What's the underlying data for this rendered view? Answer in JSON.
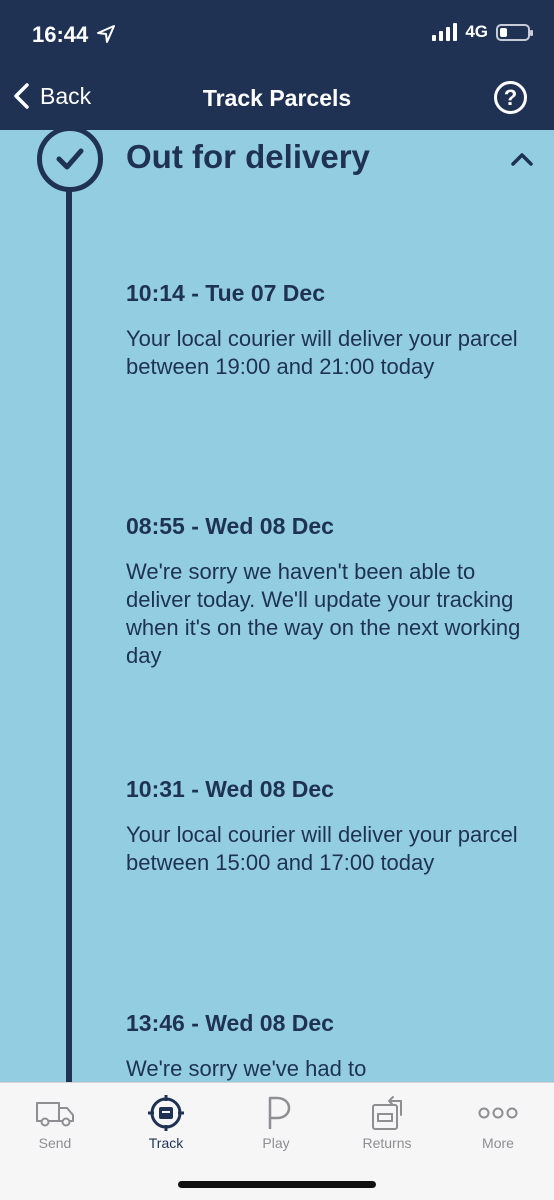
{
  "status_bar": {
    "time": "16:44",
    "network": "4G"
  },
  "nav": {
    "back_label": "Back",
    "title": "Track Parcels",
    "help_symbol": "?"
  },
  "section": {
    "title": "Out for delivery",
    "icon": "check-circle-icon"
  },
  "events": [
    {
      "time": "10:14 - Tue 07 Dec",
      "description": "Your local courier will deliver your parcel between 19:00 and 21:00 today"
    },
    {
      "time": "08:55 - Wed 08 Dec",
      "description": "We're sorry we haven't been able to deliver today. We'll update your tracking when it's on the way on the next working day"
    },
    {
      "time": "10:31 - Wed 08 Dec",
      "description": "Your local courier will deliver your parcel between 15:00 and 17:00 today"
    },
    {
      "time": "13:46 - Wed 08 Dec",
      "description": "We're sorry we've had to"
    }
  ],
  "tabs": [
    {
      "label": "Send",
      "icon": "van-icon",
      "active": false
    },
    {
      "label": "Track",
      "icon": "target-parcel-icon",
      "active": true
    },
    {
      "label": "Play",
      "icon": "play-p-icon",
      "active": false
    },
    {
      "label": "Returns",
      "icon": "returns-box-icon",
      "active": false
    },
    {
      "label": "More",
      "icon": "more-dots-icon",
      "active": false
    }
  ],
  "colors": {
    "header_bg": "#1f3254",
    "content_bg": "#92cde1",
    "text_dark": "#1f3254",
    "tab_inactive": "#8e8e93"
  }
}
